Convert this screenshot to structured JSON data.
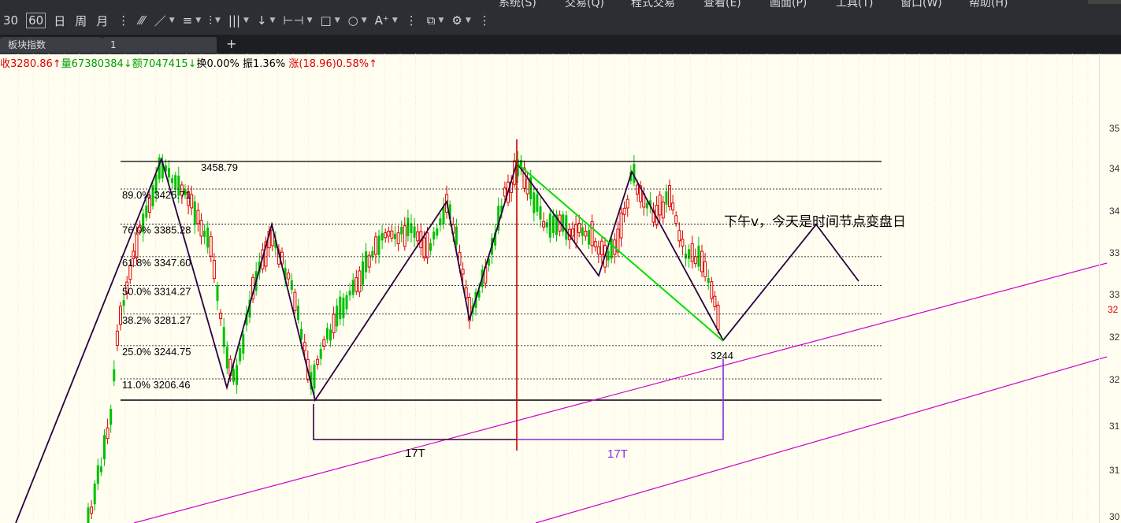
{
  "toolbar": {
    "period_30": "30",
    "period_60": "60",
    "period_day": "日",
    "period_week": "周",
    "period_month": "月"
  },
  "menu": [
    "系统(S)",
    "交易(Q)",
    "程式交易",
    "查看(E)",
    "画面(P)",
    "工具(T)",
    "窗口(W)",
    "帮助(H)"
  ],
  "tabs": [
    "板块指数",
    "1"
  ],
  "add_tab_label": "+",
  "quote": {
    "close": "收3280.86↑",
    "volume": "量67380384↓",
    "amount": "额7047415↓",
    "turnover": "换0.00%",
    "amplitude": "振1.36%",
    "change": "涨(18.96)0.58%↑"
  },
  "colors": {
    "up": "#e00000",
    "down": "#00c000",
    "fib_line": "#000000",
    "zigzag": "#2a0040",
    "trend_green": "#00dd00",
    "channel": "#cc00cc",
    "vline": "#cc0000",
    "bracket2": "#8a2be2"
  },
  "chart_data": {
    "type": "candlestick-annotated",
    "high_label": "3458.79",
    "fib_levels": [
      {
        "label": "89.0% 3425.71",
        "value": 3425.71
      },
      {
        "label": "76.0% 3385.28",
        "value": 3385.28
      },
      {
        "label": "61.8% 3347.60",
        "value": 3347.6
      },
      {
        "label": "50.0% 3314.27",
        "value": 3314.27
      },
      {
        "label": "38.2% 3281.27",
        "value": 3281.27
      },
      {
        "label": "25.0% 3244.75",
        "value": 3244.75
      },
      {
        "label": "11.0% 3206.46",
        "value": 3206.46
      }
    ],
    "low_mark": "3244",
    "annotation": "下午v，今天是时间节点变盘日",
    "time_labels": [
      "17T",
      "17T"
    ],
    "y_tick_labels": [
      "35",
      "34",
      "34",
      "33",
      "33",
      "32",
      "32",
      "31",
      "31",
      "30"
    ],
    "y_current_label": "32"
  }
}
